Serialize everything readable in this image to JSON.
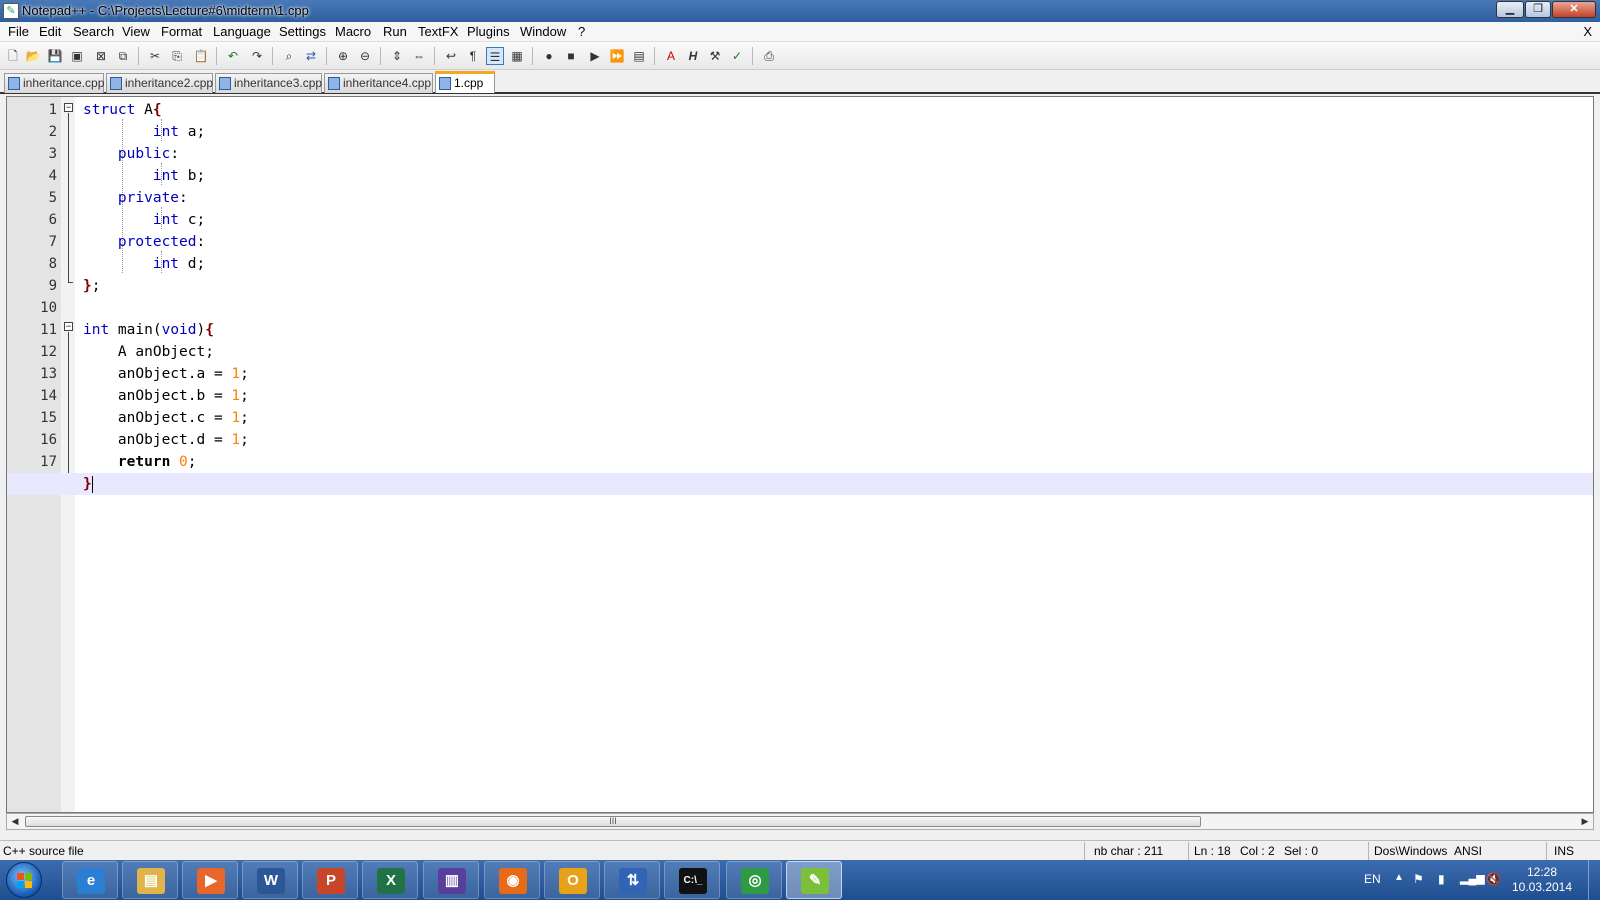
{
  "window": {
    "title": "Notepad++ - C:\\Projects\\Lecture#6\\midterm\\1.cpp",
    "minimize": "▁",
    "restore": "❐",
    "close": "✕"
  },
  "menu": {
    "items": [
      "File",
      "Edit",
      "Search",
      "View",
      "Format",
      "Language",
      "Settings",
      "Macro",
      "Run",
      "TextFX",
      "Plugins",
      "Window",
      "?"
    ],
    "close_doc": "X"
  },
  "toolbar": {
    "icons": [
      "new-file-icon",
      "open-file-icon",
      "save-icon",
      "save-all-icon",
      "close-icon",
      "close-all-icon",
      "cut-icon",
      "copy-icon",
      "paste-icon",
      "undo-icon",
      "redo-icon",
      "find-icon",
      "replace-icon",
      "zoom-in-icon",
      "zoom-out-icon",
      "sync-vertical-icon",
      "sync-horizontal-icon",
      "word-wrap-icon",
      "show-all-chars-icon",
      "indent-guide-icon",
      "user-lang-icon",
      "record-macro-icon",
      "stop-macro-icon",
      "play-macro-icon",
      "run-macro-multiple-icon",
      "save-macro-icon",
      "acrobat-icon",
      "html-tag-icon",
      "tools-icon",
      "spellcheck-icon",
      "print-icon"
    ]
  },
  "tabs": [
    {
      "label": "inheritance.cpp",
      "active": false
    },
    {
      "label": "inheritance2.cpp",
      "active": false
    },
    {
      "label": "inheritance3.cpp",
      "active": false
    },
    {
      "label": "inheritance4.cpp",
      "active": false
    },
    {
      "label": "1.cpp",
      "active": true
    }
  ],
  "editor": {
    "lines": [
      {
        "n": "1",
        "text": "struct A{"
      },
      {
        "n": "2",
        "text": "        int a;"
      },
      {
        "n": "3",
        "text": "    public:"
      },
      {
        "n": "4",
        "text": "        int b;"
      },
      {
        "n": "5",
        "text": "    private:"
      },
      {
        "n": "6",
        "text": "        int c;"
      },
      {
        "n": "7",
        "text": "    protected:"
      },
      {
        "n": "8",
        "text": "        int d;"
      },
      {
        "n": "9",
        "text": "};"
      },
      {
        "n": "10",
        "text": ""
      },
      {
        "n": "11",
        "text": "int main(void){"
      },
      {
        "n": "12",
        "text": "    A anObject;"
      },
      {
        "n": "13",
        "text": "    anObject.a = 1;"
      },
      {
        "n": "14",
        "text": "    anObject.b = 1;"
      },
      {
        "n": "15",
        "text": "    anObject.c = 1;"
      },
      {
        "n": "16",
        "text": "    anObject.d = 1;"
      },
      {
        "n": "17",
        "text": "    return 0;"
      },
      {
        "n": "18",
        "text": "}"
      }
    ],
    "current_line": 18
  },
  "scrollbar": {
    "grip": "III",
    "left": "◀",
    "right": "▶"
  },
  "status": {
    "file_type": "C++ source file",
    "nb_char": "nb char : 211",
    "ln": "Ln : 18",
    "col": "Col : 2",
    "sel": "Sel : 0",
    "eol": "Dos\\Windows",
    "encoding": "ANSI",
    "mode": "INS"
  },
  "taskbar": {
    "apps": [
      {
        "name": "internet-explorer",
        "glyph": "e",
        "color": "#2a7fd4"
      },
      {
        "name": "file-explorer",
        "glyph": "▤",
        "color": "#e0b44a"
      },
      {
        "name": "media-player",
        "glyph": "▶",
        "color": "#e8662a"
      },
      {
        "name": "word",
        "glyph": "W",
        "color": "#2b5797"
      },
      {
        "name": "powerpoint",
        "glyph": "P",
        "color": "#c9452a"
      },
      {
        "name": "excel",
        "glyph": "X",
        "color": "#217346"
      },
      {
        "name": "visual-studio",
        "glyph": "▥",
        "color": "#5a3e9c"
      },
      {
        "name": "firefox",
        "glyph": "◉",
        "color": "#e66a18"
      },
      {
        "name": "outlook",
        "glyph": "O",
        "color": "#e8a21a"
      },
      {
        "name": "remote-tool",
        "glyph": "⇅",
        "color": "#3065b5"
      },
      {
        "name": "command-prompt",
        "glyph": "C:\\_",
        "color": "#111111"
      },
      {
        "name": "chrome",
        "glyph": "◎",
        "color": "#2e9a44"
      },
      {
        "name": "notepad-plus-plus",
        "glyph": "✎",
        "color": "#7bbf3a"
      }
    ],
    "language": "EN",
    "time": "12:28",
    "date": "10.03.2014"
  }
}
